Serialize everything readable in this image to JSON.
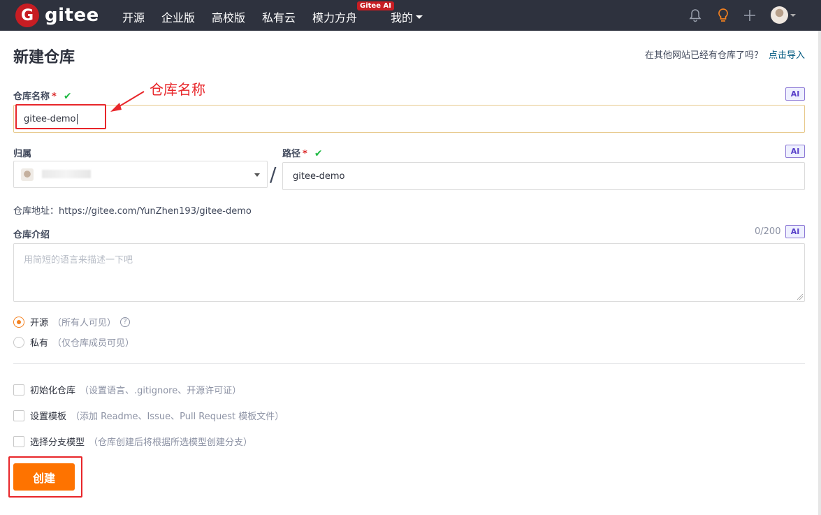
{
  "nav": {
    "logo_mark": "G",
    "logo_text": "gitee",
    "items": [
      "开源",
      "企业版",
      "高校版",
      "私有云",
      "模力方舟",
      "我的"
    ],
    "ai_badge": "Gitee AI"
  },
  "page": {
    "title": "新建仓库",
    "import_hint": "在其他网站已经有仓库了吗？",
    "import_link": "点击导入"
  },
  "form": {
    "ai_tag": "AI",
    "repo_name_label": "仓库名称",
    "required_mark": "*",
    "repo_name_value": "gitee-demo",
    "owner_label": "归属",
    "path_label": "路径",
    "path_value": "gitee-demo",
    "slash": "/",
    "repo_url_label": "仓库地址：",
    "repo_url_value": "https://gitee.com/YunZhen193/gitee-demo",
    "intro_label": "仓库介绍",
    "intro_counter": "0/200",
    "intro_placeholder": "用简短的语言来描述一下吧",
    "visibility": [
      {
        "label": "开源",
        "desc": "（所有人可见）",
        "selected": true
      },
      {
        "label": "私有",
        "desc": "（仅仓库成员可见）",
        "selected": false
      }
    ],
    "options": [
      {
        "label": "初始化仓库",
        "desc": "（设置语言、.gitignore、开源许可证）"
      },
      {
        "label": "设置模板",
        "desc": "（添加 Readme、Issue、Pull Request 模板文件）"
      },
      {
        "label": "选择分支模型",
        "desc": "（仓库创建后将根据所选模型创建分支）"
      }
    ],
    "create_button": "创建"
  },
  "annotation": {
    "text": "仓库名称",
    "color": "#e8262a"
  },
  "colors": {
    "topbar": "#2e323e",
    "brand": "#c71d23",
    "primary_button": "#fe7300",
    "radio_selected": "#f4811f",
    "check_valid": "#21ba45"
  },
  "icons": [
    "bell-icon",
    "lightbulb-icon",
    "plus-icon",
    "check-icon",
    "help-icon",
    "chevron-down-icon"
  ]
}
